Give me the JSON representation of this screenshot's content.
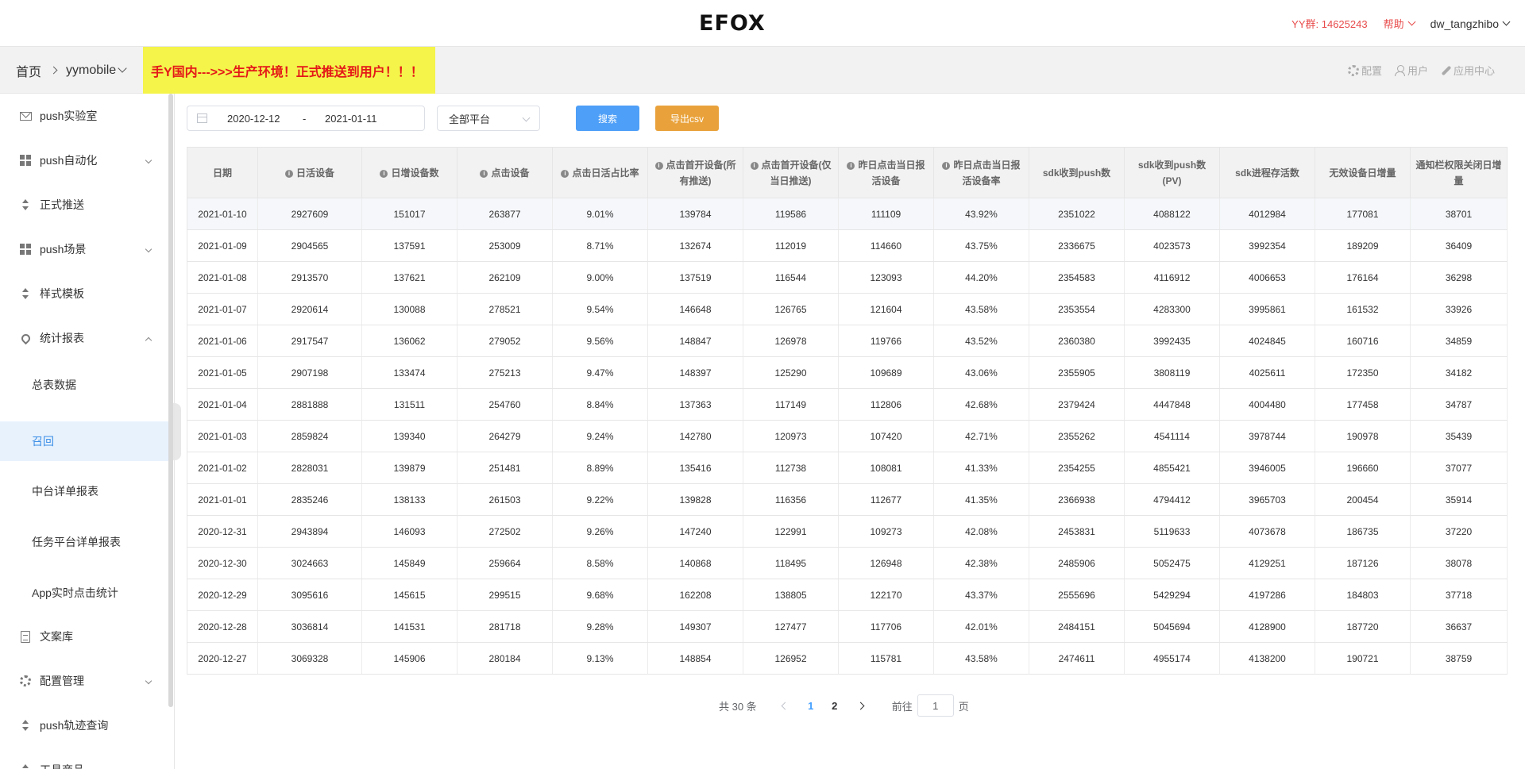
{
  "header": {
    "logo": "EFOX",
    "yy_group": "YY群: 14625243",
    "help": "帮助",
    "user": "dw_tangzhibo"
  },
  "subheader": {
    "breadcrumb_home": "首页",
    "breadcrumb_app": "yymobile",
    "warning": "手Y国内--->>>生产环境！正式推送到用户！！！",
    "links": {
      "config": "配置",
      "user": "用户",
      "app_center": "应用中心"
    }
  },
  "sidebar": {
    "items": [
      {
        "label": "push实验室",
        "icon": "mail-icon"
      },
      {
        "label": "push自动化",
        "icon": "grid-icon"
      },
      {
        "label": "正式推送",
        "icon": "sort-icon"
      },
      {
        "label": "push场景",
        "icon": "grid-icon"
      },
      {
        "label": "样式模板",
        "icon": "sort-icon"
      },
      {
        "label": "统计报表",
        "icon": "location-icon"
      },
      {
        "label": "文案库",
        "icon": "document-icon"
      },
      {
        "label": "配置管理",
        "icon": "gear-icon"
      },
      {
        "label": "push轨迹查询",
        "icon": "sort-icon"
      },
      {
        "label": "工具商品",
        "icon": "sort-icon"
      }
    ],
    "subitems": [
      {
        "label": "总表数据"
      },
      {
        "label": "召回"
      },
      {
        "label": "中台详单报表"
      },
      {
        "label": "任务平台详单报表"
      },
      {
        "label": "App实时点击统计"
      }
    ]
  },
  "filters": {
    "date_start": "2020-12-12",
    "date_separator": "-",
    "date_end": "2021-01-11",
    "platform": "全部平台",
    "search_button": "搜索",
    "export_button": "导出csv"
  },
  "table": {
    "headers": [
      {
        "label": "日期",
        "info": false
      },
      {
        "label": "日活设备",
        "info": true
      },
      {
        "label": "日增设备数",
        "info": true
      },
      {
        "label": "点击设备",
        "info": true
      },
      {
        "label": "点击日活占比率",
        "info": true
      },
      {
        "label": "点击首开设备(所有推送)",
        "info": true
      },
      {
        "label": "点击首开设备(仅当日推送)",
        "info": true
      },
      {
        "label": "昨日点击当日报活设备",
        "info": true
      },
      {
        "label": "昨日点击当日报活设备率",
        "info": true
      },
      {
        "label": "sdk收到push数",
        "info": false
      },
      {
        "label": "sdk收到push数(PV)",
        "info": false
      },
      {
        "label": "sdk进程存活数",
        "info": false
      },
      {
        "label": "无效设备日增量",
        "info": false
      },
      {
        "label": "通知栏权限关闭日增量",
        "info": false
      }
    ],
    "rows": [
      [
        "2021-01-10",
        "2927609",
        "151017",
        "263877",
        "9.01%",
        "139784",
        "119586",
        "111109",
        "43.92%",
        "2351022",
        "4088122",
        "4012984",
        "177081",
        "38701"
      ],
      [
        "2021-01-09",
        "2904565",
        "137591",
        "253009",
        "8.71%",
        "132674",
        "112019",
        "114660",
        "43.75%",
        "2336675",
        "4023573",
        "3992354",
        "189209",
        "36409"
      ],
      [
        "2021-01-08",
        "2913570",
        "137621",
        "262109",
        "9.00%",
        "137519",
        "116544",
        "123093",
        "44.20%",
        "2354583",
        "4116912",
        "4006653",
        "176164",
        "36298"
      ],
      [
        "2021-01-07",
        "2920614",
        "130088",
        "278521",
        "9.54%",
        "146648",
        "126765",
        "121604",
        "43.58%",
        "2353554",
        "4283300",
        "3995861",
        "161532",
        "33926"
      ],
      [
        "2021-01-06",
        "2917547",
        "136062",
        "279052",
        "9.56%",
        "148847",
        "126978",
        "119766",
        "43.52%",
        "2360380",
        "3992435",
        "4024845",
        "160716",
        "34859"
      ],
      [
        "2021-01-05",
        "2907198",
        "133474",
        "275213",
        "9.47%",
        "148397",
        "125290",
        "109689",
        "43.06%",
        "2355905",
        "3808119",
        "4025611",
        "172350",
        "34182"
      ],
      [
        "2021-01-04",
        "2881888",
        "131511",
        "254760",
        "8.84%",
        "137363",
        "117149",
        "112806",
        "42.68%",
        "2379424",
        "4447848",
        "4004480",
        "177458",
        "34787"
      ],
      [
        "2021-01-03",
        "2859824",
        "139340",
        "264279",
        "9.24%",
        "142780",
        "120973",
        "107420",
        "42.71%",
        "2355262",
        "4541114",
        "3978744",
        "190978",
        "35439"
      ],
      [
        "2021-01-02",
        "2828031",
        "139879",
        "251481",
        "8.89%",
        "135416",
        "112738",
        "108081",
        "41.33%",
        "2354255",
        "4855421",
        "3946005",
        "196660",
        "37077"
      ],
      [
        "2021-01-01",
        "2835246",
        "138133",
        "261503",
        "9.22%",
        "139828",
        "116356",
        "112677",
        "41.35%",
        "2366938",
        "4794412",
        "3965703",
        "200454",
        "35914"
      ],
      [
        "2020-12-31",
        "2943894",
        "146093",
        "272502",
        "9.26%",
        "147240",
        "122991",
        "109273",
        "42.08%",
        "2453831",
        "5119633",
        "4073678",
        "186735",
        "37220"
      ],
      [
        "2020-12-30",
        "3024663",
        "145849",
        "259664",
        "8.58%",
        "140868",
        "118495",
        "126948",
        "42.38%",
        "2485906",
        "5052475",
        "4129251",
        "187126",
        "38078"
      ],
      [
        "2020-12-29",
        "3095616",
        "145615",
        "299515",
        "9.68%",
        "162208",
        "138805",
        "122170",
        "43.37%",
        "2555696",
        "5429294",
        "4197286",
        "184803",
        "37718"
      ],
      [
        "2020-12-28",
        "3036814",
        "141531",
        "281718",
        "9.28%",
        "149307",
        "127477",
        "117706",
        "42.01%",
        "2484151",
        "5045694",
        "4128900",
        "187720",
        "36637"
      ],
      [
        "2020-12-27",
        "3069328",
        "145906",
        "280184",
        "9.13%",
        "148854",
        "126952",
        "115781",
        "43.58%",
        "2474611",
        "4955174",
        "4138200",
        "190721",
        "38759"
      ]
    ]
  },
  "pagination": {
    "total": "共 30 条",
    "pages": [
      "1",
      "2"
    ],
    "goto_prefix": "前往",
    "goto_value": "1",
    "goto_suffix": "页"
  },
  "colors": {
    "primary": "#4e9ff7",
    "warning_bg": "#f4f44a",
    "warning_text": "#e41818",
    "export": "#e9a23b",
    "active_menu": "#3a8ee6"
  }
}
